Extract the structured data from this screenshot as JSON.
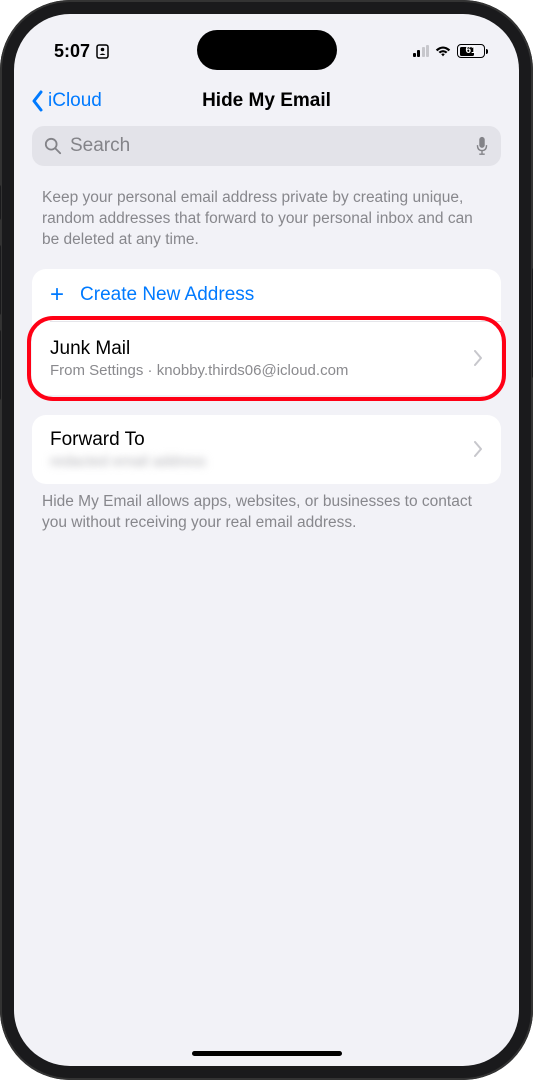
{
  "status": {
    "time": "5:07",
    "battery_pct": "61"
  },
  "nav": {
    "back_label": "iCloud",
    "title": "Hide My Email"
  },
  "search": {
    "placeholder": "Search"
  },
  "intro_text": "Keep your personal email address private by creating unique, random addresses that forward to your personal inbox and can be deleted at any time.",
  "create": {
    "label": "Create New Address",
    "plus": "+"
  },
  "alias": {
    "title": "Junk Mail",
    "subtitle": "From Settings · knobby.thirds06@icloud.com"
  },
  "forward": {
    "title": "Forward To",
    "subtitle": "redacted email address"
  },
  "footer_text": "Hide My Email allows apps, websites, or businesses to contact you without receiving your real email address."
}
